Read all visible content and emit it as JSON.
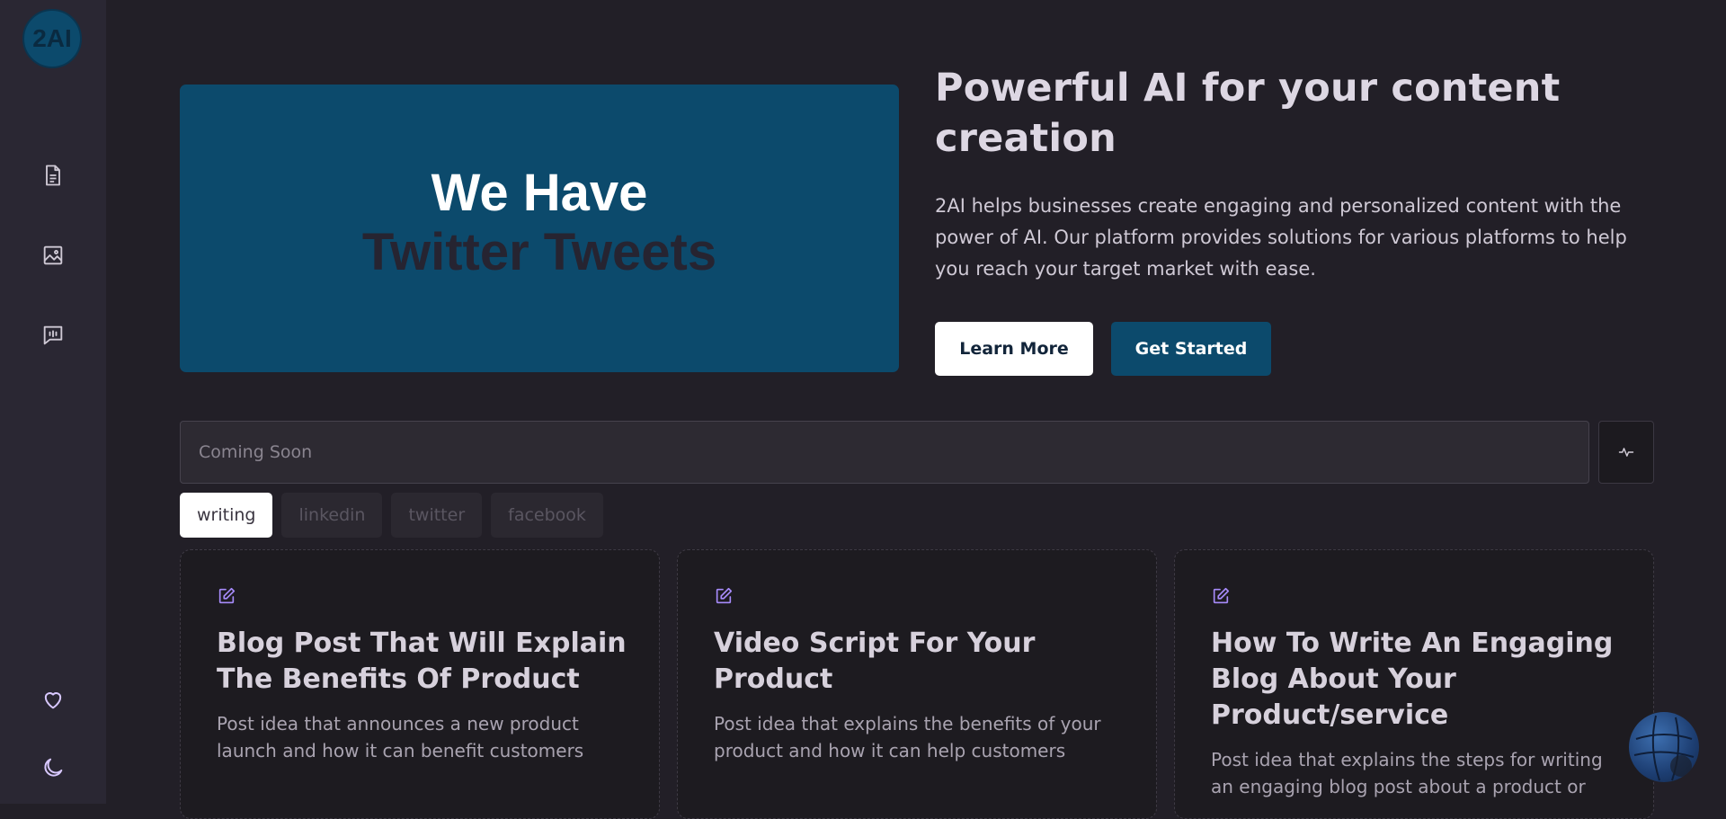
{
  "sidebar": {
    "logo_text": "2AI",
    "items": [
      {
        "icon": "document-icon"
      },
      {
        "icon": "image-icon"
      },
      {
        "icon": "voice-chat-icon"
      }
    ],
    "bottom": [
      {
        "icon": "heart-icon"
      },
      {
        "icon": "moon-icon"
      }
    ]
  },
  "hero": {
    "banner_line1": "We Have",
    "banner_line2": "Twitter Tweets",
    "title": "Powerful AI for your content creation",
    "description": "2AI helps businesses create engaging and personalized content with the power of AI. Our platform provides solutions for various platforms to help you reach your target market with ease.",
    "learn_more": "Learn More",
    "get_started": "Get Started"
  },
  "search": {
    "placeholder": "Coming Soon",
    "button_icon": "activity-icon"
  },
  "tabs": [
    {
      "label": "writing",
      "active": true
    },
    {
      "label": "linkedin",
      "active": false
    },
    {
      "label": "twitter",
      "active": false
    },
    {
      "label": "facebook",
      "active": false
    }
  ],
  "cards": [
    {
      "icon": "edit-icon",
      "title": "Blog Post That Will Explain The Benefits Of Product",
      "description": "Post idea that announces a new product launch and how it can benefit customers"
    },
    {
      "icon": "edit-icon",
      "title": "Video Script For Your Product",
      "description": "Post idea that explains the benefits of your product and how it can help customers"
    },
    {
      "icon": "edit-icon",
      "title": "How To Write An Engaging Blog About Your Product/service",
      "description": "Post idea that explains the steps for writing an engaging blog post about a product or"
    }
  ],
  "colors": {
    "background": "#221f27",
    "sidebar": "#2a2733",
    "accent": "#0c4a6c",
    "icon_accent": "#a78bfa"
  }
}
